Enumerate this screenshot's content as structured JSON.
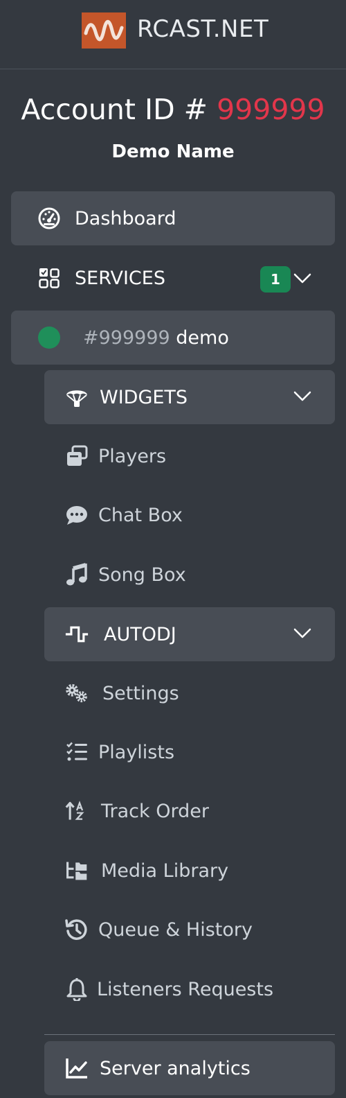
{
  "brand": {
    "name": "RCAST.NET",
    "logo_color": "#c4562a"
  },
  "account": {
    "prefix": "Account ID #",
    "id": "999999",
    "id_color": "#e2364b",
    "name": "Demo Name"
  },
  "nav": {
    "dashboard": {
      "label": "Dashboard",
      "icon": "gauge-icon"
    },
    "services": {
      "label": "SERVICES",
      "icon": "grid-icon",
      "badge": "1"
    },
    "service_item": {
      "id": "#999999",
      "name": "demo",
      "status_color": "#1f8f5a"
    },
    "widgets": {
      "label": "WIDGETS",
      "icon": "parachute-icon",
      "items": [
        {
          "label": "Players",
          "icon": "players-icon"
        },
        {
          "label": "Chat Box",
          "icon": "chat-icon"
        },
        {
          "label": "Song Box",
          "icon": "music-note-icon"
        }
      ]
    },
    "autodj": {
      "label": "AUTODJ",
      "icon": "wave-icon",
      "items": [
        {
          "label": "Settings",
          "icon": "gears-icon"
        },
        {
          "label": "Playlists",
          "icon": "list-check-icon"
        },
        {
          "label": "Track Order",
          "icon": "sort-az-icon"
        },
        {
          "label": "Media Library",
          "icon": "folder-tree-icon"
        },
        {
          "label": "Queue & History",
          "icon": "history-icon"
        },
        {
          "label": "Listeners Requests",
          "icon": "bell-icon"
        }
      ]
    },
    "analytics": {
      "label": "Server analytics",
      "icon": "chart-line-icon"
    }
  }
}
